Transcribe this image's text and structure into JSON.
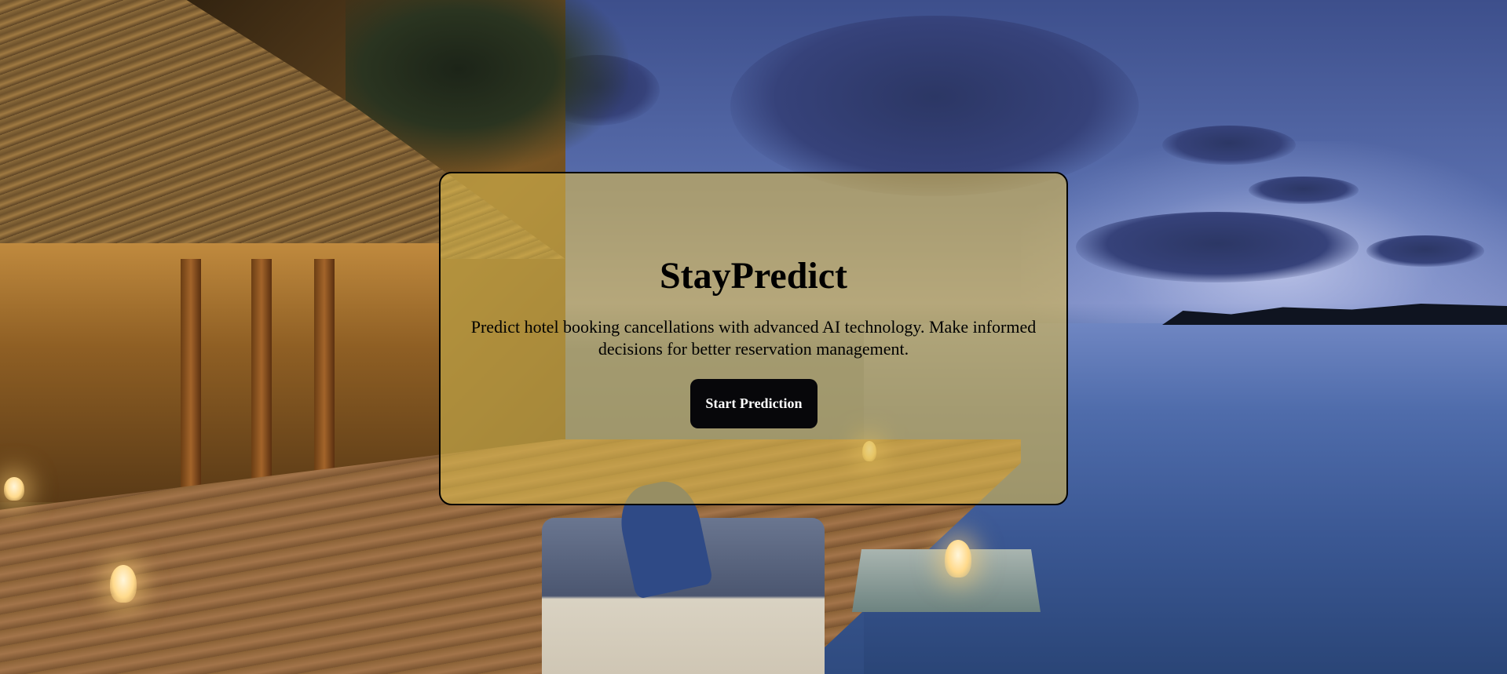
{
  "hero": {
    "title": "StayPredict",
    "tagline": "Predict hotel booking cancellations with advanced AI technology. Make informed decisions for better reservation management.",
    "cta_label": "Start Prediction"
  },
  "colors": {
    "card_overlay": "#d9b84e",
    "button_bg": "#07070a",
    "button_text": "#ffffff",
    "title_text": "#000000"
  },
  "background": {
    "description_icon": "tropical-resort-photo"
  }
}
